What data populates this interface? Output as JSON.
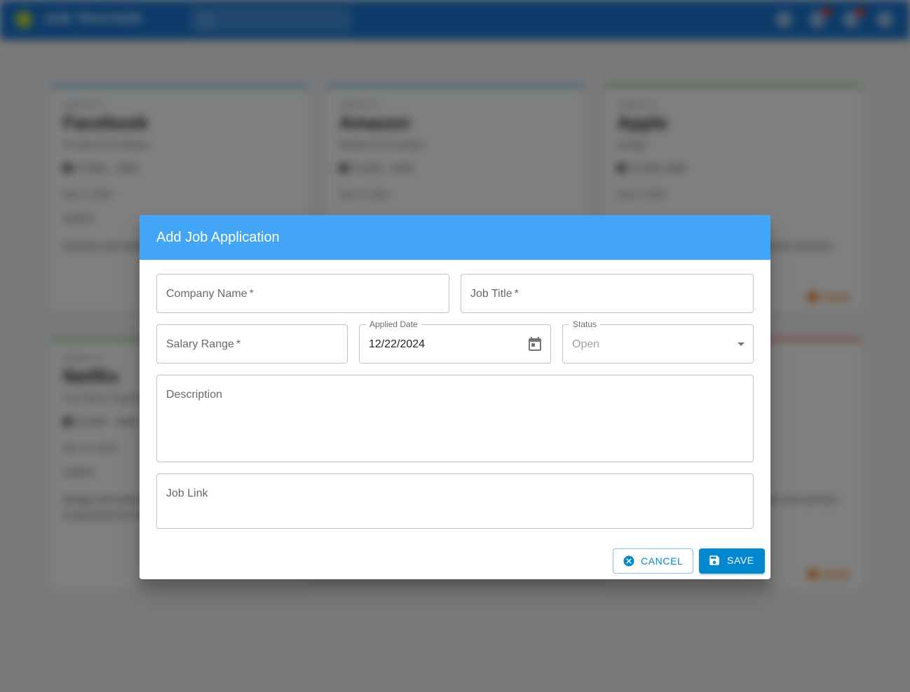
{
  "background": {
    "app_title": "JOB TRACKER",
    "cards": [
      {
        "caption": "Applied on",
        "company": "Facebook",
        "title": "Frontend Developer",
        "salary": "$ 100K - 130K",
        "date": "Dec 2, 2024",
        "status": "Applied",
        "description": "Develop and maintain user interfaces for web apps.",
        "action": ""
      },
      {
        "caption": "Applied on",
        "company": "Amazon",
        "title": "Backend Developer",
        "salary": "$ 110K - 140K",
        "date": "Dec 4, 2024",
        "status": "",
        "description": "",
        "action": ""
      },
      {
        "caption": "Applied on",
        "company": "Apple",
        "title": "Design",
        "salary": "$ 120K-150K",
        "date": "Dec 8, 2024",
        "status": "",
        "description": "Design the next generation of consumer products.",
        "action": "Delete"
      },
      {
        "caption": "Applied on",
        "company": "Netflix",
        "title": "Full Stack Engineer",
        "salary": "$ 130K - 160K",
        "date": "Dec 10, 2024",
        "status": "Applied",
        "description": "Design and build streaming infrastructure components for millions of users.",
        "action": ""
      },
      {
        "caption": "",
        "company": "",
        "title": "",
        "salary": "",
        "date": "",
        "status": "",
        "description": "Maintain and scale our cloud platform and services across regions.",
        "action": "Delete"
      }
    ]
  },
  "dialog": {
    "title": "Add Job Application",
    "fields": {
      "company_name": {
        "label": "Company Name",
        "required_mark": "*"
      },
      "job_title": {
        "label": "Job Title",
        "required_mark": "*"
      },
      "salary_range": {
        "label": "Salary Range",
        "required_mark": "*"
      },
      "applied_date": {
        "label": "Applied Date",
        "value": "12/22/2024"
      },
      "status": {
        "label": "Status",
        "value": "Open"
      },
      "description": {
        "label": "Description"
      },
      "job_link": {
        "label": "Job Link"
      }
    },
    "buttons": {
      "cancel": "Cancel",
      "save": "Save"
    }
  },
  "colors": {
    "header": "#42a5f5",
    "primary": "#0288d1",
    "appbar": "#1976d2"
  }
}
